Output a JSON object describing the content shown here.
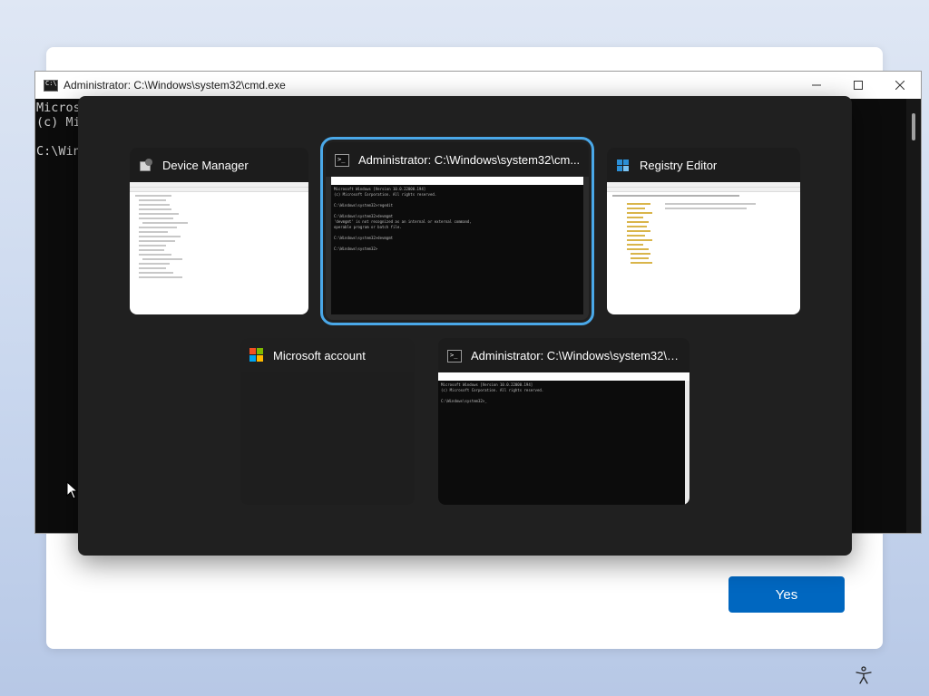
{
  "oobe": {
    "yes_label": "Yes"
  },
  "cmd_window": {
    "title": "Administrator: C:\\Windows\\system32\\cmd.exe",
    "lines": [
      "Micros",
      "(c) Mi",
      "",
      "C:\\Win"
    ],
    "icons": {
      "minimize": "minimize-icon",
      "maximize": "maximize-icon",
      "close": "close-icon"
    }
  },
  "task_switcher": {
    "tiles": [
      {
        "title": "Device Manager",
        "icon": "device-manager-icon",
        "selected": false
      },
      {
        "title": "Administrator: C:\\Windows\\system32\\cm...",
        "icon": "cmd-icon",
        "selected": true
      },
      {
        "title": "Registry Editor",
        "icon": "registry-editor-icon",
        "selected": false
      },
      {
        "title": "Microsoft account",
        "icon": "microsoft-logo-icon",
        "selected": false
      },
      {
        "title": "Administrator: C:\\Windows\\system32\\cm...",
        "icon": "cmd-icon",
        "selected": false
      }
    ]
  },
  "colors": {
    "accent": "#0067c0",
    "selection_outline": "#4aa8e8",
    "switcher_bg": "#202020"
  }
}
